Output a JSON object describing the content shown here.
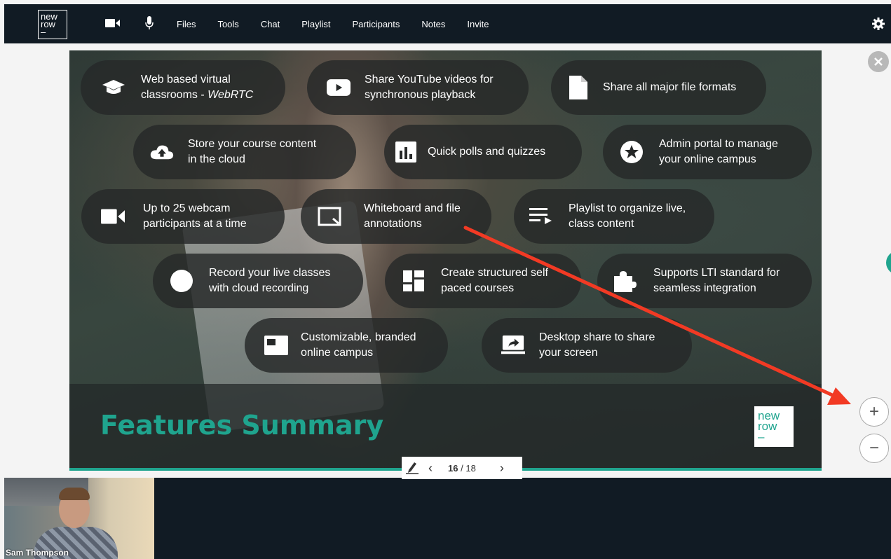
{
  "nav": {
    "logo": [
      "new",
      "row",
      "–"
    ],
    "links": [
      "Files",
      "Tools",
      "Chat",
      "Playlist",
      "Participants",
      "Notes",
      "Invite"
    ],
    "camera_icon": "video-camera-icon",
    "mic_icon": "microphone-icon",
    "settings_icon": "gear-icon"
  },
  "slide": {
    "features": [
      {
        "icon": "graduation-cap-icon",
        "line1": "Web based virtual",
        "line2_prefix": "classrooms - ",
        "line2_em": "WebRTC"
      },
      {
        "icon": "youtube-play-icon",
        "line1": "Share YouTube videos for",
        "line2": "synchronous playback"
      },
      {
        "icon": "file-icon",
        "line1": "Share all major file formats",
        "line2": ""
      },
      {
        "icon": "cloud-upload-icon",
        "line1": "Store your course content",
        "line2": "in the cloud"
      },
      {
        "icon": "bar-chart-icon",
        "line1": "Quick polls and quizzes",
        "line2": ""
      },
      {
        "icon": "star-badge-icon",
        "line1": "Admin portal to manage",
        "line2": "your online campus"
      },
      {
        "icon": "video-camera-icon",
        "line1": "Up to 25 webcam",
        "line2": "participants at a time"
      },
      {
        "icon": "annotate-icon",
        "line1": "Whiteboard and file",
        "line2": "annotations"
      },
      {
        "icon": "playlist-icon",
        "line1": "Playlist to organize live,",
        "line2": "class content"
      },
      {
        "icon": "record-circle-icon",
        "line1": "Record your live classes",
        "line2": "with cloud recording"
      },
      {
        "icon": "dashboard-icon",
        "line1": "Create structured self",
        "line2": "paced courses"
      },
      {
        "icon": "puzzle-icon",
        "line1": "Supports LTI standard for",
        "line2": "seamless integration"
      },
      {
        "icon": "branded-window-icon",
        "line1": "Customizable, branded",
        "line2": "online campus"
      },
      {
        "icon": "screen-share-icon",
        "line1": "Desktop share to share",
        "line2": "your screen"
      }
    ],
    "title": "Features Summary",
    "logo": [
      "new",
      "row",
      "–"
    ]
  },
  "pager": {
    "current": "16",
    "separator": "/",
    "total": "18"
  },
  "zoom": {
    "in": "+",
    "out": "−"
  },
  "webcam": {
    "name": "Sam Thompson"
  },
  "colors": {
    "accent": "#1fa48e",
    "annotation_arrow": "#f23a24",
    "topbar": "#111b24"
  }
}
